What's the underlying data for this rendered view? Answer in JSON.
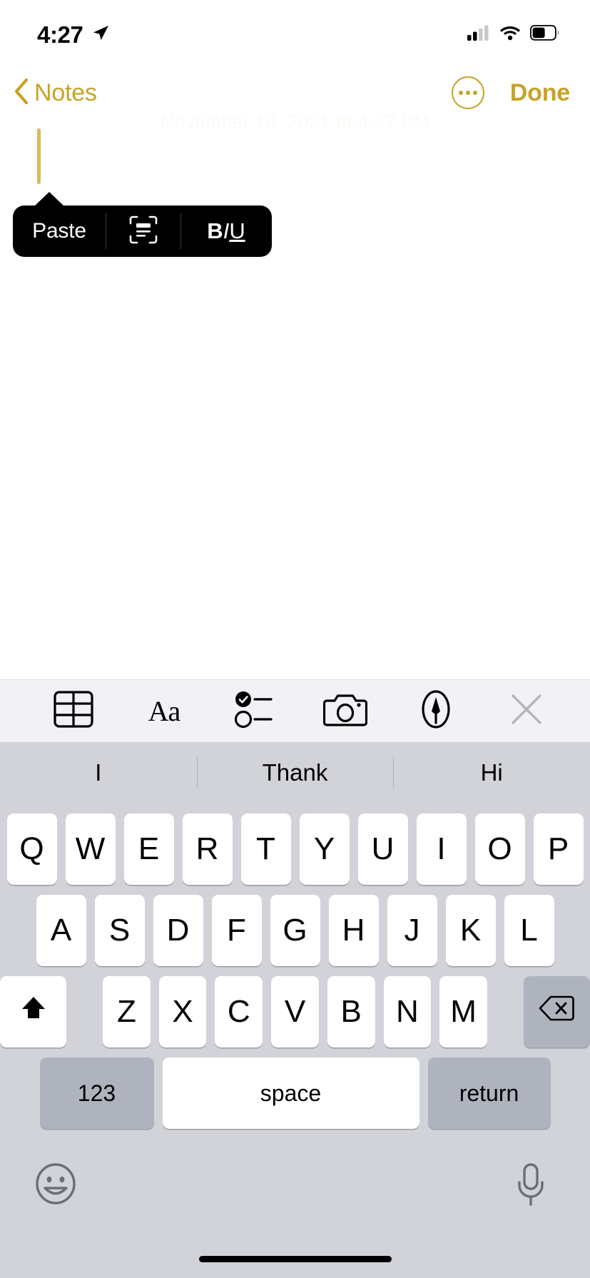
{
  "status_bar": {
    "time": "4:27",
    "location_icon": "location-arrow-icon",
    "cellular_icon": "cellular-signal-icon",
    "wifi_icon": "wifi-icon",
    "battery_icon": "battery-icon"
  },
  "nav_bar": {
    "back_label": "Notes",
    "back_chevron_icon": "chevron-left-icon",
    "more_icon": "more-ellipsis-circle-icon",
    "done_label": "Done",
    "accent_color": "#C9A227"
  },
  "note": {
    "date_text": "November 18, 2021 at 4:27 PM",
    "caret_color": "#D9BB5C",
    "body_text": ""
  },
  "edit_popup": {
    "background_color": "#000000",
    "items": [
      {
        "label": "Paste",
        "name": "paste-menu-item"
      },
      {
        "label": "",
        "name": "scan-text-menu-item",
        "icon": "scan-text-icon"
      },
      {
        "label": "BIU",
        "name": "format-biu-menu-item",
        "bold": "B",
        "italic": "I",
        "underline": "U"
      }
    ]
  },
  "keyboard_toolbar": {
    "background_color": "#f2f2f6",
    "items": [
      {
        "name": "table-button",
        "icon": "table-icon",
        "label": ""
      },
      {
        "name": "text-format-button",
        "icon": "text-format-icon",
        "label": "Aa"
      },
      {
        "name": "checklist-button",
        "icon": "checklist-icon",
        "label": ""
      },
      {
        "name": "camera-button",
        "icon": "camera-icon",
        "label": ""
      },
      {
        "name": "markup-button",
        "icon": "markup-pen-icon",
        "label": ""
      },
      {
        "name": "dismiss-keyboard-button",
        "icon": "close-x-icon",
        "label": ""
      }
    ]
  },
  "predictive_bar": {
    "background_color": "#d1d3d9",
    "suggestions": [
      "I",
      "Thank",
      "Hi"
    ]
  },
  "keyboard": {
    "background_color": "#d1d3d9",
    "row1": [
      "Q",
      "W",
      "E",
      "R",
      "T",
      "Y",
      "U",
      "I",
      "O",
      "P"
    ],
    "row2": [
      "A",
      "S",
      "D",
      "F",
      "G",
      "H",
      "J",
      "K",
      "L"
    ],
    "row3": [
      "Z",
      "X",
      "C",
      "V",
      "B",
      "N",
      "M"
    ],
    "shift_icon": "shift-up-arrow-icon",
    "backspace_icon": "backspace-delete-icon",
    "numbers_label": "123",
    "space_label": "space",
    "return_label": "return"
  },
  "keyboard_bottom": {
    "emoji_icon": "emoji-smiley-icon",
    "dictation_icon": "microphone-icon"
  },
  "home_indicator": {
    "name": "home-indicator"
  }
}
